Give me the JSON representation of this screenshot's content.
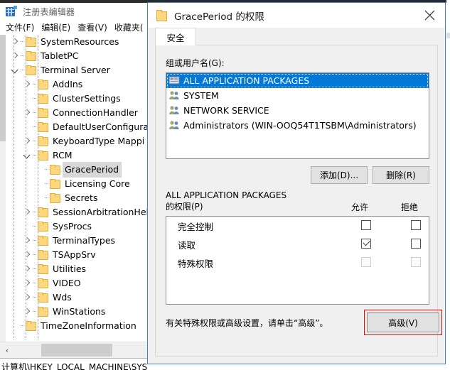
{
  "regedit": {
    "title": "注册表编辑器",
    "app_icon": "registry-editor-icon",
    "menu": [
      {
        "label": "文件(F)"
      },
      {
        "label": "编辑(E)"
      },
      {
        "label": "查看(V)"
      },
      {
        "label": "收藏夹("
      }
    ],
    "tree": [
      {
        "label": "SystemResources",
        "indent": 0,
        "state": "collapsed",
        "selected": false
      },
      {
        "label": "TabletPC",
        "indent": 0,
        "state": "collapsed",
        "selected": false
      },
      {
        "label": "Terminal Server",
        "indent": 0,
        "state": "expanded",
        "selected": false
      },
      {
        "label": "AddIns",
        "indent": 1,
        "state": "collapsed",
        "selected": false
      },
      {
        "label": "ClusterSettings",
        "indent": 1,
        "state": "leaf",
        "selected": false
      },
      {
        "label": "ConnectionHandler",
        "indent": 1,
        "state": "collapsed",
        "selected": false
      },
      {
        "label": "DefaultUserConfigurat",
        "indent": 1,
        "state": "leaf",
        "selected": false
      },
      {
        "label": "KeyboardType Mappi",
        "indent": 1,
        "state": "collapsed",
        "selected": false
      },
      {
        "label": "RCM",
        "indent": 1,
        "state": "expanded",
        "selected": false
      },
      {
        "label": "GracePeriod",
        "indent": 2,
        "state": "leaf",
        "selected": true
      },
      {
        "label": "Licensing Core",
        "indent": 2,
        "state": "leaf",
        "selected": false
      },
      {
        "label": "Secrets",
        "indent": 2,
        "state": "leaf",
        "selected": false
      },
      {
        "label": "SessionArbitrationHelp",
        "indent": 1,
        "state": "collapsed",
        "selected": false
      },
      {
        "label": "SysProcs",
        "indent": 1,
        "state": "leaf",
        "selected": false
      },
      {
        "label": "TerminalTypes",
        "indent": 1,
        "state": "collapsed",
        "selected": false
      },
      {
        "label": "TSAppSrv",
        "indent": 1,
        "state": "collapsed",
        "selected": false
      },
      {
        "label": "Utilities",
        "indent": 1,
        "state": "collapsed",
        "selected": false
      },
      {
        "label": "VIDEO",
        "indent": 1,
        "state": "collapsed",
        "selected": false
      },
      {
        "label": "Wds",
        "indent": 1,
        "state": "collapsed",
        "selected": false
      },
      {
        "label": "WinStations",
        "indent": 1,
        "state": "collapsed",
        "selected": false
      },
      {
        "label": "TimeZoneInformation",
        "indent": 0,
        "state": "leaf",
        "selected": false
      }
    ],
    "hscroll_left_arrow": "‹",
    "statusbar": "计算机\\HKEY_LOCAL_MACHINE\\SYS"
  },
  "dialog": {
    "title": "GracePeriod 的权限",
    "title_icon": "folder-icon",
    "close_icon": "close-icon",
    "tabs": [
      {
        "label": "安全",
        "active": true
      }
    ],
    "group_label": "组或用户名(G):",
    "users": [
      {
        "name": "ALL APPLICATION PACKAGES",
        "icon": "application-packages-icon",
        "selected": true
      },
      {
        "name": "SYSTEM",
        "icon": "users-group-icon",
        "selected": false
      },
      {
        "name": "NETWORK SERVICE",
        "icon": "users-group-icon",
        "selected": false
      },
      {
        "name": "Administrators (WIN-OOQ54T1TSBM\\Administrators)",
        "icon": "users-group-icon",
        "selected": false
      }
    ],
    "add_button": "添加(D)...",
    "remove_button": "删除(R)",
    "permissions_header_line1": "ALL APPLICATION PACKAGES",
    "permissions_header_line2": "的权限(P)",
    "col_allow": "允许",
    "col_deny": "拒绝",
    "permissions": [
      {
        "name": "完全控制",
        "allow": false,
        "deny": false,
        "disabled": false
      },
      {
        "name": "读取",
        "allow": true,
        "deny": false,
        "disabled": false
      },
      {
        "name": "特殊权限",
        "allow": false,
        "deny": false,
        "disabled": true
      }
    ],
    "hint": "有关特殊权限或高级设置，请单击“高级”。",
    "advanced_button": "高级(V)",
    "advanced_highlight_color": "#ff0000"
  },
  "colors": {
    "accent_blue": "#0078d7",
    "dialog_border": "#3a85c6",
    "dialog_face": "#f0f0f0",
    "folder_yellow": "#fcd77f",
    "tree_selection_gray": "#d8d8d8",
    "highlight_red": "#ff0000"
  }
}
